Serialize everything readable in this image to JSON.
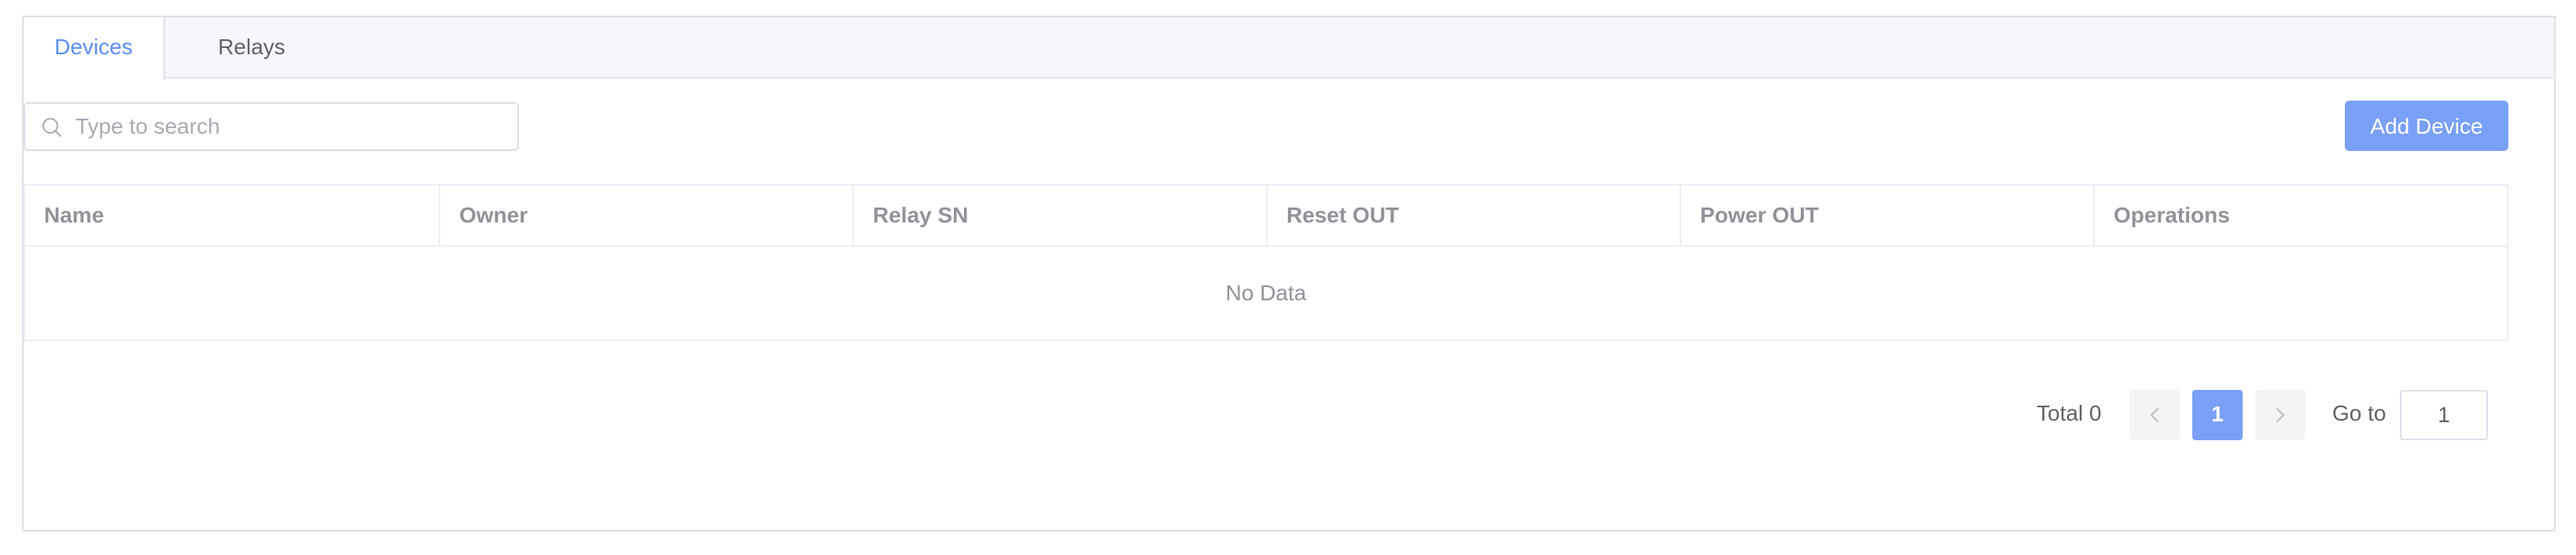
{
  "tabs": [
    {
      "label": "Devices",
      "active": true
    },
    {
      "label": "Relays",
      "active": false
    }
  ],
  "search": {
    "placeholder": "Type to search",
    "value": ""
  },
  "toolbar": {
    "add_device_label": "Add Device"
  },
  "table": {
    "columns": [
      "Name",
      "Owner",
      "Relay SN",
      "Reset OUT",
      "Power OUT",
      "Operations"
    ],
    "rows": [],
    "empty_text": "No Data"
  },
  "pagination": {
    "total_label": "Total 0",
    "current_page": "1",
    "prev_icon": "chevron-left-icon",
    "next_icon": "chevron-right-icon",
    "goto_label": "Go to",
    "goto_value": "1"
  },
  "colors": {
    "accent": "#5b8ff9",
    "button_bg": "#79a0f7"
  }
}
